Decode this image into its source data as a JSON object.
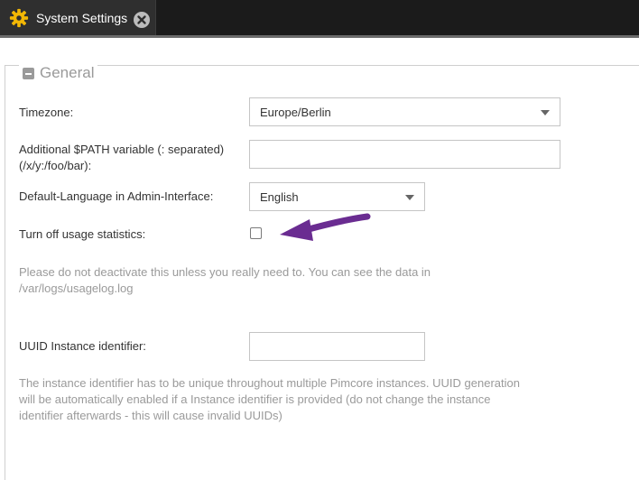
{
  "tab": {
    "title": "System Settings",
    "icon": "gear-icon",
    "close_icon": "close-icon"
  },
  "colors": {
    "tab_gear": "#f2b705",
    "arrow": "#6a2c91",
    "topbar": "#1b1b1b"
  },
  "section": {
    "legend": "General"
  },
  "fields": {
    "timezone": {
      "label": "Timezone:",
      "value": "Europe/Berlin"
    },
    "path": {
      "label_line1": "Additional $PATH variable (: separated)",
      "label_line2": "(/x/y:/foo/bar):",
      "value": ""
    },
    "language": {
      "label": "Default-Language in Admin-Interface:",
      "value": "English"
    },
    "usage": {
      "label": "Turn off usage statistics:",
      "checked": false,
      "help_line1": "Please do not deactivate this unless you really need to. You can see the data in",
      "help_line2": "/var/logs/usagelog.log"
    },
    "uuid": {
      "label": "UUID Instance identifier:",
      "value": "",
      "help_line1": "The instance identifier has to be unique throughout multiple Pimcore instances. UUID generation",
      "help_line2": "will be automatically enabled if a Instance identifier is provided (do not change the instance",
      "help_line3": "identifier afterwards - this will cause invalid UUIDs)"
    }
  }
}
